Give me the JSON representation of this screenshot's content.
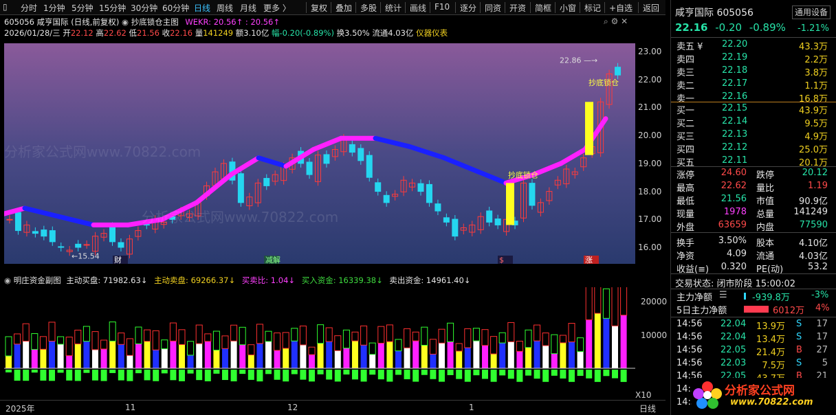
{
  "toolbar": {
    "left_items": [
      "分时",
      "1分钟",
      "5分钟",
      "15分钟",
      "30分钟",
      "60分钟",
      "日线",
      "周线",
      "月线",
      "更多 〉"
    ],
    "active": "日线",
    "right_items": [
      "复权",
      "叠加",
      "多股",
      "统计",
      "画线",
      "F10",
      "逐分",
      "同资",
      "开资",
      "简框",
      "小窗",
      "标记",
      "+自选",
      "返回"
    ]
  },
  "info": {
    "code_name": "605056 咸亨国际 (日线,前复权)",
    "indicator_name": "抄底锁仓主图",
    "wekr": "WEKR: 20.56↑ : 20.56↑",
    "date": "2026/01/28/三",
    "open_label": "开",
    "open": "22.12",
    "high_label": "高",
    "high": "22.62",
    "low_label": "低",
    "low": "21.56",
    "close_label": "收",
    "close": "22.16",
    "vol_label": "量",
    "vol": "141249",
    "amount": "额3.10亿",
    "change": "幅-0.20(-0.89%)",
    "turnover": "换3.50%",
    "float": "流通4.03亿",
    "meter": "仪器仪表"
  },
  "y_axis": [
    "23.00",
    "22.00",
    "21.00",
    "20.00",
    "19.00",
    "18.00",
    "17.00",
    "16.00"
  ],
  "chart_labels": {
    "high_mark": "22.86",
    "low_mark": "15.54",
    "signal1": "抄底锁仓",
    "signal2": "抄底锁仓",
    "event_cai": "财",
    "event_jiejin": "减解",
    "event_dollar": "$",
    "event_zhang": "涨",
    "watermark": "分析家公式网www.70822.com"
  },
  "sub_header": {
    "title": "明庄资金副图",
    "zd_buy": "主动买盘: 71982.63↓",
    "zd_sell": "主动卖盘: 69266.37↓",
    "ratio": "买卖比: 1.04↓",
    "in_fund": "买入资金: 16339.38↓",
    "out_fund": "卖出资金: 14961.40↓"
  },
  "sub_axis": [
    "20000",
    "10000"
  ],
  "x_axis": {
    "labels": [
      "2025年",
      "11",
      "12",
      "1"
    ],
    "x10": "X10",
    "period": "日线"
  },
  "quote": {
    "name": "咸亨国际",
    "code": "605056",
    "sector": "通用设备",
    "price": "22.16",
    "change": "-0.20",
    "pct": "-0.89%",
    "sector_pct": "-1.21%",
    "sells": [
      {
        "label": "卖五 ¥",
        "price": "22.20",
        "vol": "43.3万"
      },
      {
        "label": "卖四",
        "price": "22.19",
        "vol": "2.2万"
      },
      {
        "label": "卖三",
        "price": "22.18",
        "vol": "3.8万"
      },
      {
        "label": "卖二",
        "price": "22.17",
        "vol": "1.1万"
      },
      {
        "label": "卖一",
        "price": "22.16",
        "vol": "16.8万"
      }
    ],
    "buys": [
      {
        "label": "买一",
        "price": "22.15",
        "vol": "43.9万"
      },
      {
        "label": "买二",
        "price": "22.14",
        "vol": "9.5万"
      },
      {
        "label": "买三",
        "price": "22.13",
        "vol": "4.9万"
      },
      {
        "label": "买四",
        "price": "22.12",
        "vol": "25.0万"
      },
      {
        "label": "买五",
        "price": "22.11",
        "vol": "20.1万"
      }
    ],
    "stats": [
      [
        "涨停",
        "24.60",
        "跌停",
        "20.12"
      ],
      [
        "最高",
        "22.62",
        "量比",
        "1.19"
      ],
      [
        "最低",
        "21.56",
        "市值",
        "90.9亿"
      ],
      [
        "现量",
        "1978",
        "总量",
        "141249"
      ],
      [
        "外盘",
        "63659",
        "内盘",
        "77590"
      ],
      [
        "换手",
        "3.50%",
        "股本",
        "4.10亿"
      ],
      [
        "净资",
        "4.09",
        "流通",
        "4.03亿"
      ],
      [
        "收益(≡)",
        "0.320",
        "PE(动)",
        "53.2"
      ]
    ],
    "status": "交易状态: 闭市阶段 15:00:02",
    "main_flow_label": "主力净额",
    "main_flow": "-939.8万",
    "main_flow_pct": "-3%",
    "five_day_label": "5日主力净额",
    "five_day": "6012万",
    "five_day_pct": "4%",
    "ticks": [
      {
        "time": "14:56",
        "price": "22.04",
        "vol": "13.9万",
        "bs": "S",
        "n": "17"
      },
      {
        "time": "14:56",
        "price": "22.04",
        "vol": "13.4万",
        "bs": "S",
        "n": "17"
      },
      {
        "time": "14:56",
        "price": "22.05",
        "vol": "21.4万",
        "bs": "B",
        "n": "27"
      },
      {
        "time": "14:56",
        "price": "22.03",
        "vol": "7.5万",
        "bs": "S",
        "n": "5"
      },
      {
        "time": "14:56",
        "price": "22.05",
        "vol": "43.7万",
        "bs": "B",
        "n": "21"
      },
      {
        "time": "14:5",
        "price": "",
        "vol": "",
        "bs": "",
        "n": ""
      },
      {
        "time": "14:5",
        "price": "",
        "vol": "",
        "bs": "",
        "n": ""
      }
    ],
    "logo_text": "分析家公式网",
    "logo_url": "www.70822.com"
  },
  "colors": {
    "up": "#ff3b3b",
    "down": "#25d6f0",
    "ma_up": "#ff20ff",
    "ma_down": "#1a20ff",
    "signal": "#ffff20"
  }
}
